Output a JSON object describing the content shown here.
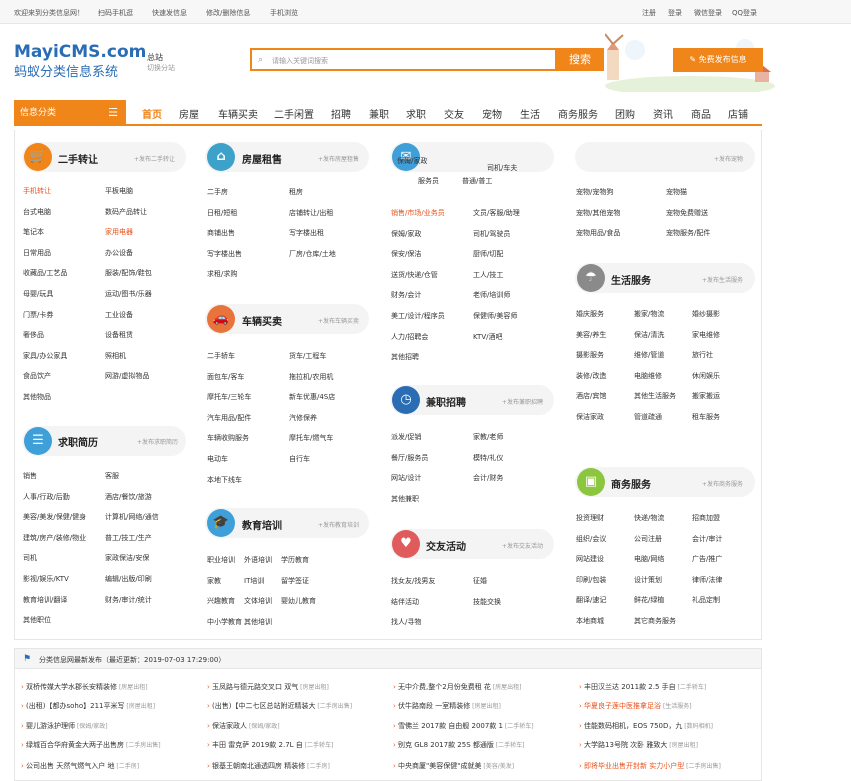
{
  "topbar": {
    "left": [
      "欢迎来到分类信息网！",
      "扫码手机逛",
      "快速发信息",
      "修改/删除信息",
      "手机浏览"
    ],
    "right": [
      "注册",
      "登录",
      "微信登录",
      "QQ登录"
    ]
  },
  "header": {
    "logo_en": "MayiCMS.com",
    "logo_cn": "蚂蚁分类信息系统",
    "city": "总站",
    "city_switch": "切换分站",
    "search_placeholder": "请输入关键词搜索",
    "search_button": "搜索",
    "post_button": "免费发布信息"
  },
  "nav": {
    "category_button": "信息分类",
    "items": [
      "首页",
      "房屋",
      "车辆买卖",
      "二手闲置",
      "招聘",
      "兼职",
      "求职",
      "交友",
      "宠物",
      "生活",
      "商务服务",
      "团购",
      "资讯",
      "商品",
      "店铺"
    ]
  },
  "colors": {
    "accent": "#f08519",
    "link_highlight": "#e8511c",
    "brand": "#2a6db5"
  },
  "categories": {
    "ershou": {
      "title": "二手转让",
      "more": "+发布二手转让",
      "icon": "cart-icon",
      "links": [
        "手机转让",
        "平板电脑",
        "台式电脑",
        "数码产品转让",
        "笔记本",
        "家用电器",
        "日常用品",
        "办公设备",
        "收藏品/工艺品",
        "服装/配饰/鞋包",
        "母婴/玩具",
        "运动/图书/乐器",
        "门票/卡券",
        "工业设备",
        "奢侈品",
        "设备租赁",
        "家具/办公家具",
        "照相机",
        "食品饮产",
        "网游/虚拟物品",
        "其他物品"
      ]
    },
    "qiuzhi": {
      "title": "求职简历",
      "more": "+发布求职简历",
      "icon": "resume-icon",
      "links": [
        "销售",
        "客服",
        "人事/行政/后勤",
        "酒店/餐饮/旅游",
        "美容/美发/保健/健身",
        "计算机/网络/通信",
        "建筑/房产/装修/物业",
        "普工/技工/生产",
        "司机",
        "家政保洁/安保",
        "影视/娱乐/KTV",
        "编辑/出版/印刷",
        "教育培训/翻译",
        "财务/审计/统计",
        "其他职位"
      ]
    },
    "fangwu": {
      "title": "房屋租售",
      "more": "+发布房屋租售",
      "icon": "house-icon",
      "links": [
        "二手房",
        "租房",
        "日租/短租",
        "店铺转让/出租",
        "商铺出售",
        "写字楼出租",
        "写字楼出售",
        "厂房/仓库/土地",
        "求租/求购"
      ]
    },
    "cheliang": {
      "title": "车辆买卖",
      "more": "+发布车辆买卖",
      "icon": "car-icon",
      "links": [
        "二手轿车",
        "货车/工程车",
        "面包车/客车",
        "拖拉机/农用机",
        "摩托车/三轮车",
        "新车优惠/4S店",
        "汽车用品/配件",
        "汽修保养",
        "车辆收购服务",
        "摩托车/燃气车",
        "电动车",
        "自行车",
        "本地下线车"
      ]
    },
    "jiaoyu": {
      "title": "教育培训",
      "more": "+发布教育培训",
      "icon": "edu-icon",
      "links": [
        "职业培训",
        "外语培训",
        "学历教育",
        "家教",
        "IT培训",
        "留学签证",
        "兴趣教育",
        "文体培训",
        "婴幼儿教育",
        "中小学教育",
        "其他培训"
      ]
    },
    "zhaopin": {
      "links_top": [
        "保姆/家政",
        "司机/车夫",
        "服务员",
        "普通/普工",
        "销售/市场/业务员",
        "文员/客服/助理",
        "保姆/家政",
        "司机/驾驶员",
        "保安/保洁",
        "厨师/切配",
        "送货/快递/仓管",
        "工人/技工",
        "财务/会计",
        "老师/培训师",
        "美工/设计/程序员",
        "保健师/美容师",
        "人力/招聘会",
        "KTV/酒吧",
        "其他招聘"
      ]
    },
    "jianzhi": {
      "title": "兼职招聘",
      "more": "+发布兼职招聘",
      "icon": "clock-icon",
      "links": [
        "派发/促销",
        "家教/老师",
        "餐厅/服务员",
        "模特/礼仪",
        "网站/设计",
        "会计/财务",
        "其他兼职"
      ]
    },
    "jiaoyou": {
      "title": "交友活动",
      "more": "+发布交友活动",
      "icon": "heart-icon",
      "links": [
        "找女友/找男友",
        "征婚",
        "结伴活动",
        "技能交换",
        "找人/寻物"
      ]
    },
    "chongwu": {
      "more": "+发布宠物",
      "links": [
        "宠物/宠物狗",
        "宠物猫",
        "宠物/其他宠物",
        "宠物免费赠送",
        "宠物用品/食品",
        "宠物服务/配件"
      ]
    },
    "shenghuo": {
      "title": "生活服务",
      "more": "+发布生活服务",
      "icon": "umbrella-icon",
      "links": [
        "婚庆服务",
        "搬家/物流",
        "婚纱摄影",
        "美容/养生",
        "保洁/清洗",
        "家电维修",
        "摄影服务",
        "维修/管道",
        "旅行社",
        "装修/改造",
        "电脑维修",
        "休闲娱乐",
        "酒店/宾馆",
        "其他生活服务",
        "搬家搬运",
        "保洁家政",
        "管道疏通",
        "租车服务",
        "家居维修",
        "外卖/送水",
        "开锁/修锁"
      ]
    },
    "shangwu": {
      "title": "商务服务",
      "more": "+发布商务服务",
      "icon": "briefcase-icon",
      "links": [
        "投资理财",
        "快递/物流",
        "招商加盟",
        "组织/会议",
        "公司注册",
        "会计/审计",
        "网站建设",
        "电脑/网络",
        "广告/推广",
        "印刷/包装",
        "设计策划",
        "律师/法律",
        "翻译/速记",
        "鲜花/绿植",
        "礼品定制",
        "本地商城",
        "其它商务服务"
      ]
    }
  },
  "news": {
    "header": "分类信息网最新发布（最近更新：2019-07-03 17:29:00）",
    "items": [
      [
        "双桥传媒大学水郡长安精装修",
        "[房屋出租]"
      ],
      [
        "玉凤路与德元路交叉口 双气",
        "[房屋出租]"
      ],
      [
        "无中介费,整个2月份免费租 花",
        "[房屋出租]"
      ],
      [
        "丰田汉兰达 2011款 2.5 手自",
        "[二手轿车]"
      ],
      [
        "(出租)【都办soho】211平米写",
        "[房屋出租]"
      ],
      [
        "(出售)【中二七区总站附近精装大",
        "[二手房出售]"
      ],
      [
        "伏牛路南段 一室精装修",
        "[房屋出租]"
      ],
      [
        "华夏良子莲中医推拿足浴",
        "[生活服务]"
      ],
      [
        "婴儿游泳护理师",
        "[保姆/家政]"
      ],
      [
        "保洁家政人",
        "[保姆/家政]"
      ],
      [
        "雪佛兰 2017款 自由舰 2007款 1",
        "[二手轿车]"
      ],
      [
        "佳能数码相机，EOS 750D，九",
        "[数码相机]"
      ],
      [
        "绿城百合华府黄金大两子出售房",
        "[二手房出售]"
      ],
      [
        "丰田 雷克萨 2019款 2.7L 自",
        "[二手轿车]"
      ],
      [
        "别克 GL8 2017款 25S 都通版",
        "[二手轿车]"
      ],
      [
        "大学路13号院 次卧 雅致大",
        "[房屋出租]"
      ],
      [
        "公司出售 天然气燃气入户 地",
        "[二手房]"
      ],
      [
        "银基王朝南北通透四房 精装修",
        "[二手房]"
      ],
      [
        "中央商厦\"美容保健\"成就美",
        "[美容/美发]"
      ],
      [
        "即将毕业出售开封新 实力小户型",
        "[二手房出售]"
      ]
    ]
  }
}
